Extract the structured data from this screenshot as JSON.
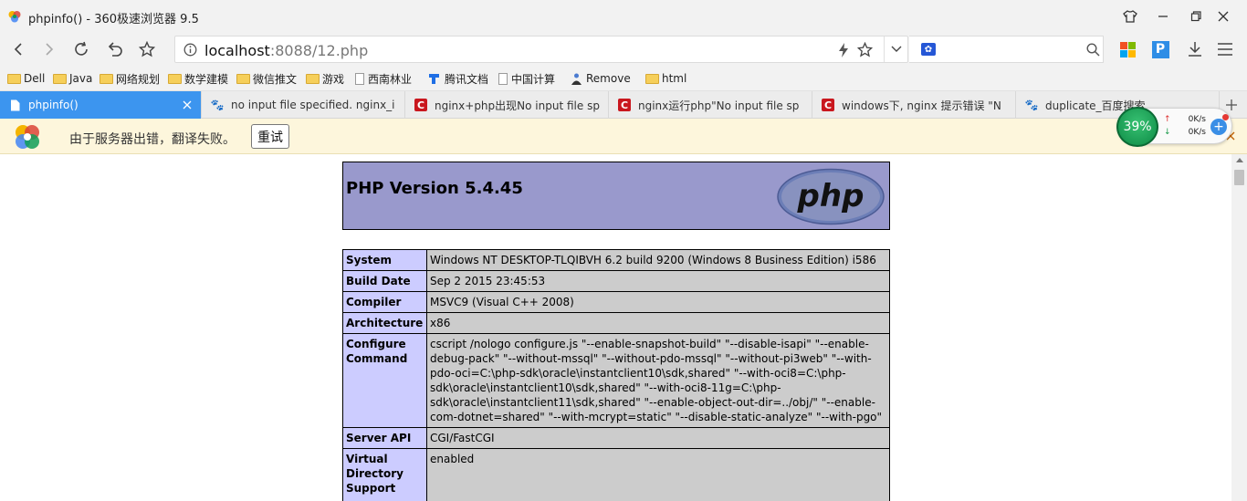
{
  "window": {
    "title": "phpinfo() - 360极速浏览器 9.5"
  },
  "nav": {
    "url_host": "localhost",
    "url_rest": ":8088/12.php"
  },
  "bookmarks": [
    {
      "label": "Dell",
      "icon": "folder"
    },
    {
      "label": "Java",
      "icon": "folder"
    },
    {
      "label": "网络规划",
      "icon": "folder"
    },
    {
      "label": "数学建模",
      "icon": "folder"
    },
    {
      "label": "微信推文",
      "icon": "folder"
    },
    {
      "label": "游戏",
      "icon": "folder"
    },
    {
      "label": "西南林业",
      "icon": "page"
    },
    {
      "label": "腾讯文档",
      "icon": "tencent-docs"
    },
    {
      "label": "中国计算",
      "icon": "page"
    },
    {
      "label": "Remove",
      "icon": "remove"
    },
    {
      "label": "html",
      "icon": "folder"
    }
  ],
  "tabs": [
    {
      "label": "phpinfo()",
      "icon": "page",
      "active": true
    },
    {
      "label": "no input file specified. nginx_i",
      "icon": "baidu"
    },
    {
      "label": "nginx+php出现No input file sp",
      "icon": "csdn"
    },
    {
      "label": "nginx运行php\"No input file sp",
      "icon": "csdn"
    },
    {
      "label": "windows下, nginx 提示错误 \"N",
      "icon": "csdn"
    },
    {
      "label": "duplicate_百度搜索",
      "icon": "baidu"
    }
  ],
  "translate_bar": {
    "message": "由于服务器出错，翻译失败。",
    "retry_label": "重试"
  },
  "net_widget": {
    "percent": "39%",
    "up": "0K/s",
    "down": "0K/s"
  },
  "php": {
    "version_title": "PHP Version 5.4.45",
    "logo_text": "php",
    "rows": [
      {
        "key": "System",
        "value": "Windows NT DESKTOP-TLQIBVH 6.2 build 9200 (Windows 8 Business Edition) i586"
      },
      {
        "key": "Build Date",
        "value": "Sep 2 2015 23:45:53"
      },
      {
        "key": "Compiler",
        "value": "MSVC9 (Visual C++ 2008)"
      },
      {
        "key": "Architecture",
        "value": "x86"
      },
      {
        "key": "Configure Command",
        "value": "cscript /nologo configure.js \"--enable-snapshot-build\" \"--disable-isapi\" \"--enable-debug-pack\" \"--without-mssql\" \"--without-pdo-mssql\" \"--without-pi3web\" \"--with-pdo-oci=C:\\php-sdk\\oracle\\instantclient10\\sdk,shared\" \"--with-oci8=C:\\php-sdk\\oracle\\instantclient10\\sdk,shared\" \"--with-oci8-11g=C:\\php-sdk\\oracle\\instantclient11\\sdk,shared\" \"--enable-object-out-dir=../obj/\" \"--enable-com-dotnet=shared\" \"--with-mcrypt=static\" \"--disable-static-analyze\" \"--with-pgo\""
      },
      {
        "key": "Server API",
        "value": "CGI/FastCGI"
      },
      {
        "key": "Virtual Directory Support",
        "value": "enabled"
      }
    ]
  }
}
